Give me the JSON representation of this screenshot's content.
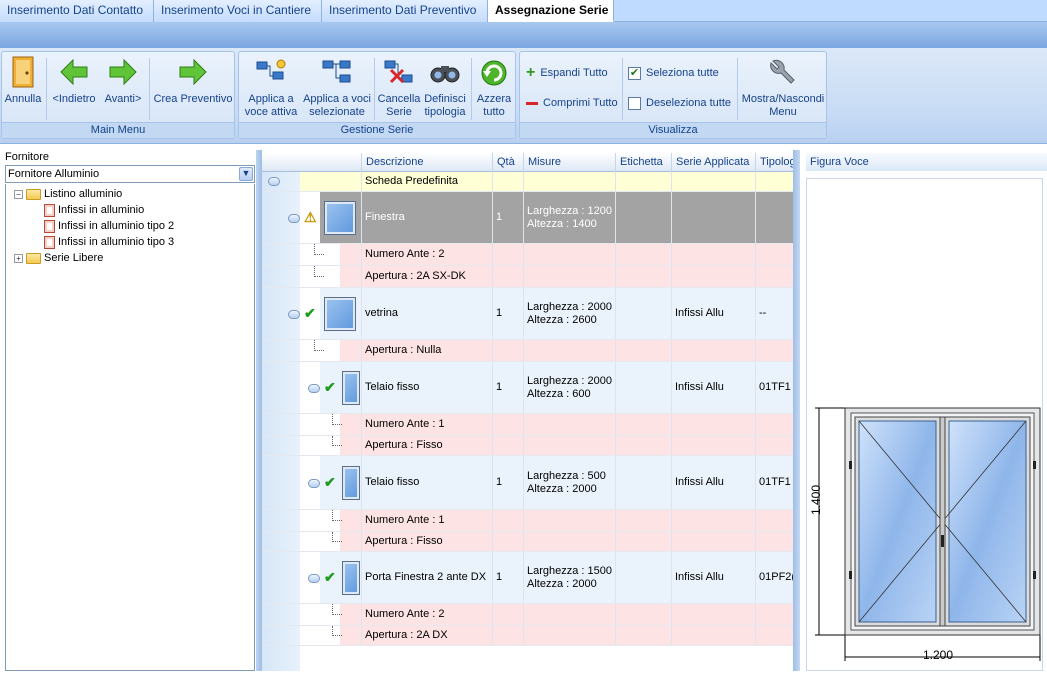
{
  "tabs": [
    {
      "label": "Inserimento Dati Contatto"
    },
    {
      "label": "Inserimento Voci in Cantiere"
    },
    {
      "label": "Inserimento Dati Preventivo"
    },
    {
      "label": "Assegnazione Serie"
    }
  ],
  "ribbon": {
    "main_menu": {
      "caption": "Main Menu",
      "annulla": "Annulla",
      "indietro": "<Indietro",
      "avanti": "Avanti>",
      "crea_preventivo": "Crea Preventivo"
    },
    "gestione_serie": {
      "caption": "Gestione Serie",
      "applica_attiva_1": "Applica a",
      "applica_attiva_2": "voce attiva",
      "applica_sel_1": "Applica a voci",
      "applica_sel_2": "selezionate",
      "cancella_1": "Cancella",
      "cancella_2": "Serie",
      "definisci_1": "Definisci",
      "definisci_2": "tipologia",
      "azzera_1": "Azzera",
      "azzera_2": "tutto"
    },
    "visualizza": {
      "caption": "Visualizza",
      "espandi": "Espandi Tutto",
      "comprimi": "Comprimi Tutto",
      "seleziona": "Seleziona tutte",
      "deseleziona": "Deseleziona tutte",
      "mostra_1": "Mostra/Nascondi",
      "mostra_2": "Menu"
    }
  },
  "left_panel": {
    "label": "Fornitore",
    "combo_value": "Fornitore Alluminio",
    "tree": [
      {
        "label": "Listino alluminio"
      },
      {
        "label": "Infissi in alluminio"
      },
      {
        "label": "Infissi in alluminio tipo 2"
      },
      {
        "label": "Infissi in alluminio tipo 3"
      },
      {
        "label": "Serie Libere"
      }
    ]
  },
  "grid": {
    "columns": [
      "Descrizione",
      "Qtà",
      "Misure",
      "Etichetta",
      "Serie Applicata",
      "Tipolog"
    ],
    "rows": [
      {
        "desc": "Scheda Predefinita",
        "qta": "",
        "m1": "",
        "m2": "",
        "serie": "",
        "tip": ""
      },
      {
        "desc": "Finestra",
        "qta": "1",
        "m1": "Larghezza : 1200",
        "m2": "Altezza : 1400",
        "serie": "",
        "tip": ""
      },
      {
        "desc": "Numero Ante : 2",
        "qta": "",
        "m1": "",
        "m2": "",
        "serie": "",
        "tip": ""
      },
      {
        "desc": "Apertura : 2A SX-DK",
        "qta": "",
        "m1": "",
        "m2": "",
        "serie": "",
        "tip": ""
      },
      {
        "desc": "vetrina",
        "qta": "1",
        "m1": "Larghezza : 2000",
        "m2": "Altezza : 2600",
        "serie": "Infissi Allu",
        "tip": "--"
      },
      {
        "desc": "Apertura : Nulla",
        "qta": "",
        "m1": "",
        "m2": "",
        "serie": "",
        "tip": ""
      },
      {
        "desc": "Telaio fisso",
        "qta": "1",
        "m1": "Larghezza : 2000",
        "m2": "Altezza : 600",
        "serie": "Infissi Allu",
        "tip": "01TF1"
      },
      {
        "desc": "Numero Ante : 1",
        "qta": "",
        "m1": "",
        "m2": "",
        "serie": "",
        "tip": ""
      },
      {
        "desc": "Apertura : Fisso",
        "qta": "",
        "m1": "",
        "m2": "",
        "serie": "",
        "tip": ""
      },
      {
        "desc": "Telaio fisso",
        "qta": "1",
        "m1": "Larghezza : 500",
        "m2": "Altezza : 2000",
        "serie": "Infissi Allu",
        "tip": "01TF1"
      },
      {
        "desc": "Numero Ante : 1",
        "qta": "",
        "m1": "",
        "m2": "",
        "serie": "",
        "tip": ""
      },
      {
        "desc": "Apertura : Fisso",
        "qta": "",
        "m1": "",
        "m2": "",
        "serie": "",
        "tip": ""
      },
      {
        "desc": "Porta Finestra 2 ante DX",
        "qta": "1",
        "m1": "Larghezza : 1500",
        "m2": "Altezza : 2000",
        "serie": "Infissi Allu",
        "tip": "01PF2("
      },
      {
        "desc": "Numero Ante : 2",
        "qta": "",
        "m1": "",
        "m2": "",
        "serie": "",
        "tip": ""
      },
      {
        "desc": "Apertura : 2A DX",
        "qta": "",
        "m1": "",
        "m2": "",
        "serie": "",
        "tip": ""
      }
    ]
  },
  "figure": {
    "title": "Figura Voce",
    "height_dim": "1.400",
    "width_dim": "1.200"
  },
  "colors": {
    "accent": "#15428b",
    "warning_row": "#a3a3a3",
    "property_row": "#fde3e3",
    "item_row": "#eaf3fc",
    "default_row": "#ffffd6",
    "check": "#1c9b1c"
  }
}
